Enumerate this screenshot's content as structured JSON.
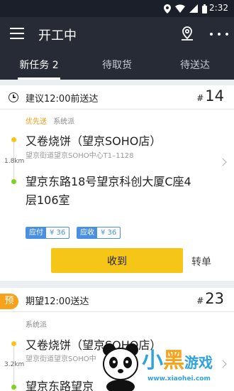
{
  "status_bar": {
    "time": "2:32",
    "icons": [
      "location-icon",
      "wifi-icon",
      "signal-icon",
      "battery-icon"
    ]
  },
  "app_bar": {
    "title": "开工中",
    "icons": [
      "menu-icon",
      "location-pin-icon",
      "more-icon"
    ]
  },
  "tabs": [
    {
      "label": "新任务 2",
      "active": true
    },
    {
      "label": "待取货",
      "active": false
    },
    {
      "label": "待送达",
      "active": false
    }
  ],
  "orders": [
    {
      "deadline": "建议12:00前送达",
      "order_hash": "#",
      "order_no": "14",
      "tag_priority": "优先送",
      "tag_dispatch": "系统派",
      "distance": "1.8km",
      "shop_name": "又卷烧饼（望京SOHO店）",
      "shop_address": "望京街道望京SOHO中心T1–1128",
      "customer_address": "望京东路18号望京科创大厦C座4层106室",
      "payments": [
        {
          "label": "应付",
          "amount": "¥ 36"
        },
        {
          "label": "应收",
          "amount": "¥ 36"
        }
      ],
      "receive_label": "收到",
      "transfer_label": "转单"
    },
    {
      "badge": "预",
      "deadline": "期望12:00送达",
      "order_hash": "#",
      "order_no": "23",
      "tag_dispatch": "系统派",
      "distance": "3.2km",
      "shop_name": "又卷烧饼（望京SOHO店）",
      "shop_address": "望京街道望京SOHO中",
      "customer_address": "望京东路望京"
    }
  ],
  "watermark": {
    "text_part1": "小",
    "text_part2": "黑",
    "text_part3": "游戏",
    "url": "www.xiaohei.com"
  },
  "colors": {
    "app_bar": "#262b36",
    "accent_yellow": "#f5c518",
    "pay_blue": "#4a90e2",
    "priority_orange": "#f39c12",
    "customer_green": "#7ed321"
  }
}
